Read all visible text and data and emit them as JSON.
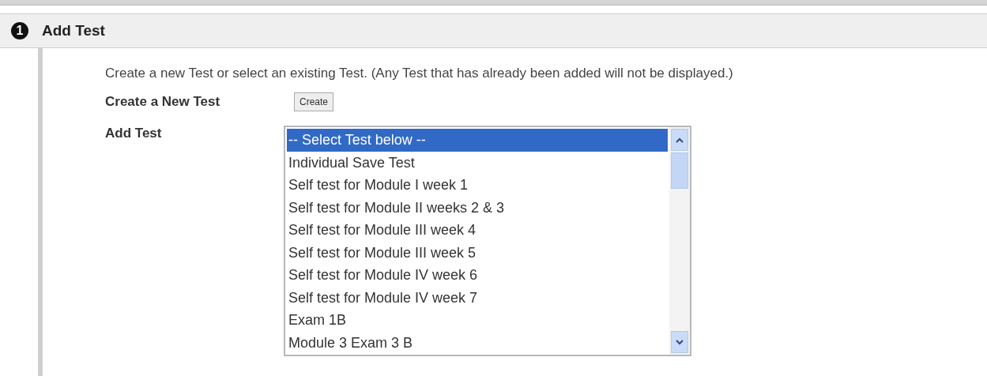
{
  "step": {
    "number": "1",
    "title": "Add Test"
  },
  "instructions": "Create a new Test or select an existing Test. (Any Test that has already been added will not be displayed.)",
  "create": {
    "label": "Create a New Test",
    "button": "Create"
  },
  "add": {
    "label": "Add Test",
    "options": [
      {
        "text": "-- Select Test below --",
        "selected": true
      },
      {
        "text": "Individual Save Test",
        "selected": false
      },
      {
        "text": "Self test for Module I week 1",
        "selected": false
      },
      {
        "text": "Self test for Module II weeks 2 & 3",
        "selected": false
      },
      {
        "text": "Self test for Module III week 4",
        "selected": false
      },
      {
        "text": "Self test for Module III week 5",
        "selected": false
      },
      {
        "text": "Self test for Module IV week 6",
        "selected": false
      },
      {
        "text": "Self test for Module IV week 7",
        "selected": false
      },
      {
        "text": "Exam 1B",
        "selected": false
      },
      {
        "text": "Module 3 Exam 3 B",
        "selected": false
      }
    ]
  }
}
